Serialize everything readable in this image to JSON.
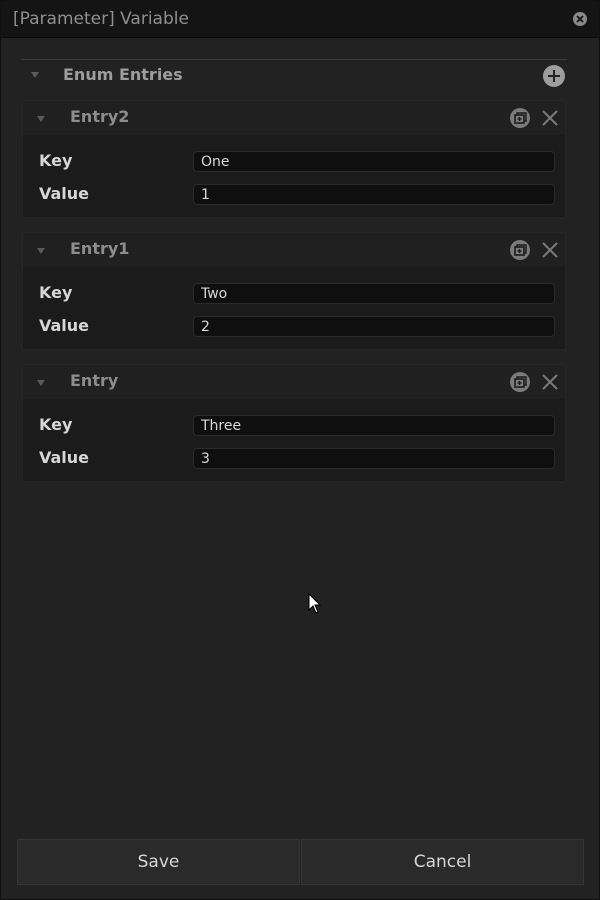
{
  "window": {
    "title": "[Parameter] Variable"
  },
  "section": {
    "title": "Enum Entries"
  },
  "entries": [
    {
      "title": "Entry2",
      "key_label": "Key",
      "key_value": "One",
      "value_label": "Value",
      "value_value": "1"
    },
    {
      "title": "Entry1",
      "key_label": "Key",
      "key_value": "Two",
      "value_label": "Value",
      "value_value": "2"
    },
    {
      "title": "Entry",
      "key_label": "Key",
      "key_value": "Three",
      "value_label": "Value",
      "value_value": "3"
    }
  ],
  "footer": {
    "save_label": "Save",
    "cancel_label": "Cancel"
  },
  "icons": {
    "close": "close-icon",
    "add": "plus-circle-icon",
    "duplicate": "duplicate-icon",
    "delete": "x-icon",
    "collapse": "triangle-down-icon"
  },
  "colors": {
    "background": "#222222",
    "titlebar": "#141414",
    "field": "#0f0f0f",
    "text": "#d6d6d6"
  }
}
